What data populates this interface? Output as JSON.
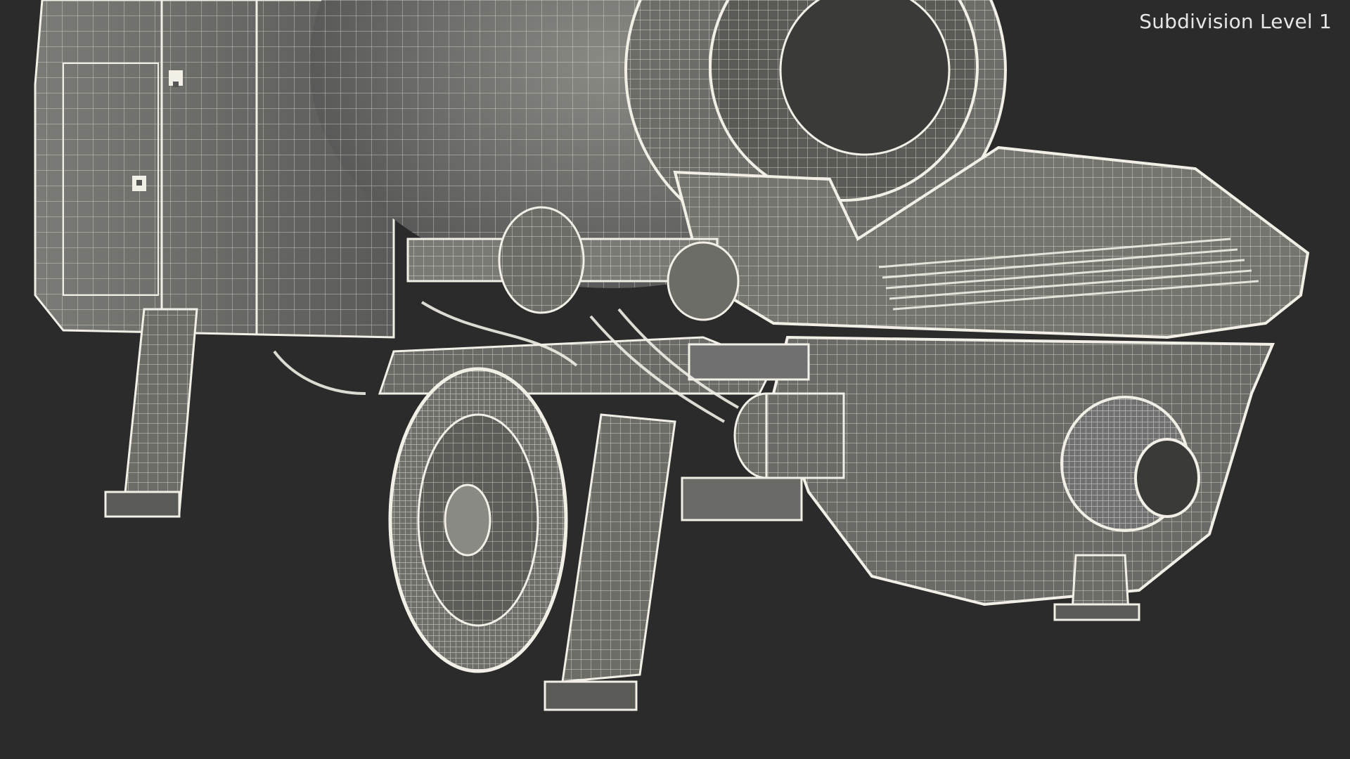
{
  "viewport": {
    "background": "#2b2b2b",
    "wire_color": "#f1efe6",
    "shade_color": "#6e6e6a",
    "overlay_label": "Subdivision Level 1"
  }
}
